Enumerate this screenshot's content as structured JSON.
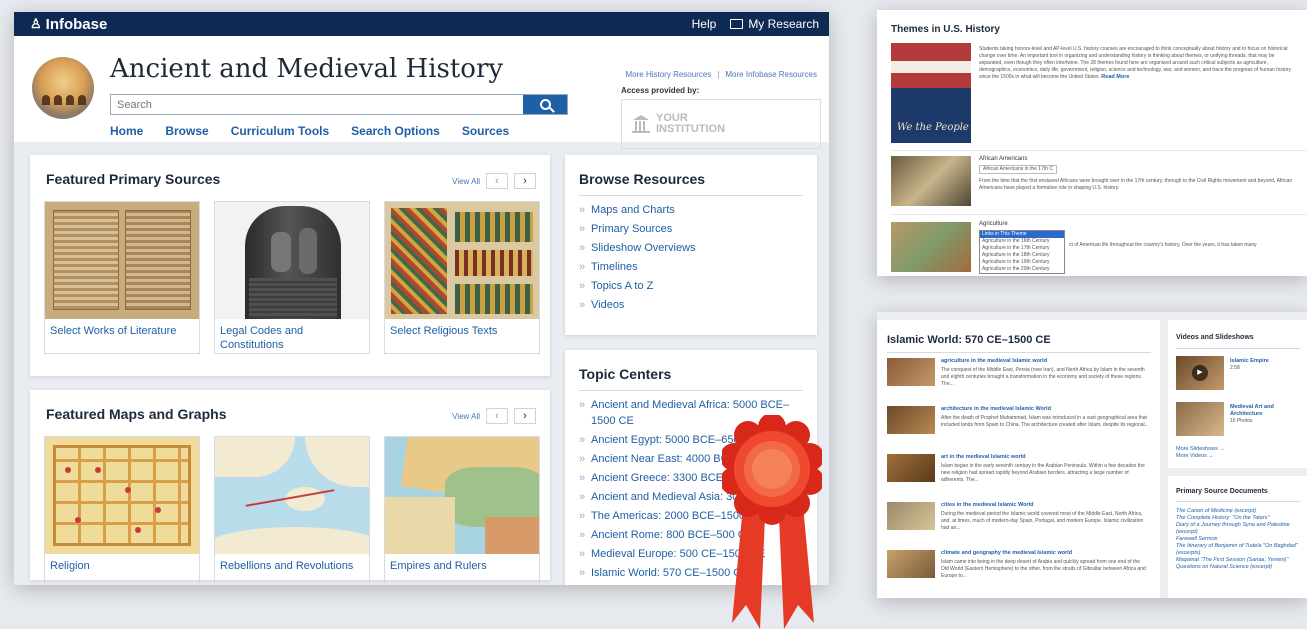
{
  "topbar": {
    "logo_bold": "Infobase",
    "help": "Help",
    "my_research": "My Research"
  },
  "header": {
    "title": "Ancient and Medieval History",
    "search_placeholder": "Search",
    "nav": [
      "Home",
      "Browse",
      "Curriculum Tools",
      "Search Options",
      "Sources"
    ],
    "more_history": "More History Resources",
    "more_infobase": "More Infobase Resources",
    "access_label": "Access provided by:",
    "institution_line1": "YOUR",
    "institution_line2": "INSTITUTION"
  },
  "primary_sources": {
    "title": "Featured Primary Sources",
    "view_all": "View All",
    "items": [
      "Select Works of Literature",
      "Legal Codes and Constitutions",
      "Select Religious Texts"
    ]
  },
  "maps_graphs": {
    "title": "Featured Maps and Graphs",
    "view_all": "View All",
    "items": [
      "Religion",
      "Rebellions and Revolutions",
      "Empires and Rulers"
    ]
  },
  "browse_resources": {
    "title": "Browse Resources",
    "items": [
      "Maps and Charts",
      "Primary Sources",
      "Slideshow Overviews",
      "Timelines",
      "Topics A to Z",
      "Videos"
    ]
  },
  "topic_centers": {
    "title": "Topic Centers",
    "items": [
      "Ancient and Medieval Africa: 5000 BCE–1500 CE",
      "Ancient Egypt: 5000 BCE–650 CE",
      "Ancient Near East: 4000 BCE–65",
      "Ancient Greece: 3300 BCE–30",
      "Ancient and Medieval Asia: 30",
      "The Americas: 2000 BCE–1500",
      "Ancient Rome: 800 BCE–500 CE",
      "Medieval Europe: 500 CE–1500 CE",
      "Islamic World: 570 CE–1500 CE"
    ]
  },
  "us_history": {
    "title": "Themes in U.S. History",
    "intro": "Students taking honors-level and AP-level U.S. history courses are encouraged to think conceptually about history and to focus on historical change over time. An important tool in organizing and understanding history is thinking about themes, or unifying threads, that may be separated, even though they often intertwine. The 28 themes found here are organized around such critical subjects as agriculture, demographics, economics, daily life, government, religion, science and technology, war, and women, and trace the progress of human history since the 1500s in what will become the United States.",
    "read_more": "Read More",
    "theme1": "African Americans",
    "theme1_select": "African Americans in the 17th C",
    "theme1_text": "From the time that the first enslaved Africans were brought over in the 17th century, through to the Civil Rights movement and beyond, African Americans have played a formative role in shaping U.S. history.",
    "theme2": "Agriculture",
    "theme2_options": [
      "Links in This Theme",
      "Agriculture in the 16th Century",
      "Agriculture in the 17th Century",
      "Agriculture in the 18th Century",
      "Agriculture in the 19th Century",
      "Agriculture in the 20th Century"
    ],
    "theme2_text": "ct of American life throughout the country's history. Over the years, it has taken many"
  },
  "islamic": {
    "title": "Islamic World: 570 CE–1500 CE",
    "entries": [
      {
        "title": "agriculture in the medieval Islamic world",
        "text": "The conquest of the Middle East, Persia (now Iran), and North Africa by Islam in the seventh and eighth centuries brought a transformation in the economy and society of these regions. The..."
      },
      {
        "title": "architecture in the medieval Islamic World",
        "text": "After the death of Prophet Muhammad, Islam was introduced in a vast geographical area that included lands from Spain to China. The architecture created after Islam, despite its regional..."
      },
      {
        "title": "art in the medieval Islamic world",
        "text": "Islam began in the early seventh century in the Arabian Peninsula. Within a few decades the new religion had spread rapidly beyond Arabian borders, attracting a large number of adherents. The..."
      },
      {
        "title": "cities in the medieval Islamic World",
        "text": "During the medieval period the Islamic world covered most of the Middle East, North Africa, and, at times, much of modern-day Spain, Portugal, and modern Europe. Islamic civilization had an..."
      },
      {
        "title": "climate and geography the medieval Islamic world",
        "text": "Islam came into being in the deep desert of Arabia and quickly spread from one end of the Old World (Eastern Hemisphere) to the other, from the straits of Gibraltar between Africa and Europe to..."
      }
    ],
    "videos_title": "Videos and Slideshows",
    "video1": "Islamic Empire",
    "video1_len": "2:58",
    "video2": "Medieval Art and Architecture",
    "video2_len": "15 Photos",
    "more_slideshows": "More Slideshows →",
    "more_videos": "More Videos →",
    "psd_title": "Primary Source Documents",
    "psd": [
      "The Canon of Medicine (excerpt)",
      "The Complete History: \"On the Tatars\"",
      "Diary of a Journey through Syria and Palestine (excerpt)",
      "Farewell Sermon",
      "The Itinerary of Benjamin of Tudela \"On Baghdad\" (excerpts)",
      "Maqamat \"The First Session (Sanaa, Yemen)\"",
      "Questions on Natural Science (excerpt)"
    ]
  }
}
